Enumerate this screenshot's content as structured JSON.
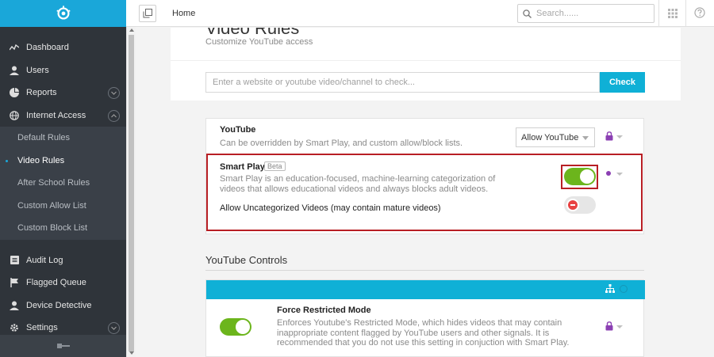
{
  "sidebar": {
    "items": [
      {
        "label": "Dashboard",
        "icon": "chart-line-icon"
      },
      {
        "label": "Users",
        "icon": "user-icon"
      },
      {
        "label": "Reports",
        "icon": "pie-chart-icon"
      },
      {
        "label": "Internet Access",
        "icon": "globe-icon"
      }
    ],
    "subitems": [
      {
        "label": "Default Rules"
      },
      {
        "label": "Video Rules"
      },
      {
        "label": "After School Rules"
      },
      {
        "label": "Custom Allow List"
      },
      {
        "label": "Custom Block List"
      }
    ],
    "items2": [
      {
        "label": "Audit Log",
        "icon": "list-icon"
      },
      {
        "label": "Flagged Queue",
        "icon": "flag-icon"
      },
      {
        "label": "Device Detective",
        "icon": "user-icon"
      },
      {
        "label": "Settings",
        "icon": "gear-icon"
      }
    ]
  },
  "topbar": {
    "breadcrumb": "Home",
    "search_placeholder": "Search......"
  },
  "page": {
    "title": "Video Rules",
    "subtitle": "Customize YouTube access"
  },
  "check": {
    "placeholder": "Enter a website or youtube video/channel to check...",
    "button": "Check"
  },
  "youtube": {
    "title": "YouTube",
    "subtitle": "Can be overridden by Smart Play, and custom allow/block lists.",
    "select_value": "Allow YouTube"
  },
  "smart_play": {
    "title": "Smart Play",
    "badge": "Beta",
    "description": "Smart Play is an education-focused, machine-learning categorization of videos that allows educational videos and always blocks adult videos.",
    "uncategorized_label": "Allow Uncategorized Videos (may contain mature videos)"
  },
  "controls": {
    "section_title": "YouTube Controls",
    "restricted_title": "Force Restricted Mode",
    "restricted_desc": "Enforces Youtube's Restricted Mode, which hides videos that may contain inappropriate content flagged by YouTube users and other signals. It is recommended that you do not use this setting in conjuction with Smart Play."
  },
  "colors": {
    "accent": "#1aa7d9",
    "toggle_on": "#6cb51c",
    "highlight": "#b81e24",
    "lock": "#8b3fb3"
  }
}
